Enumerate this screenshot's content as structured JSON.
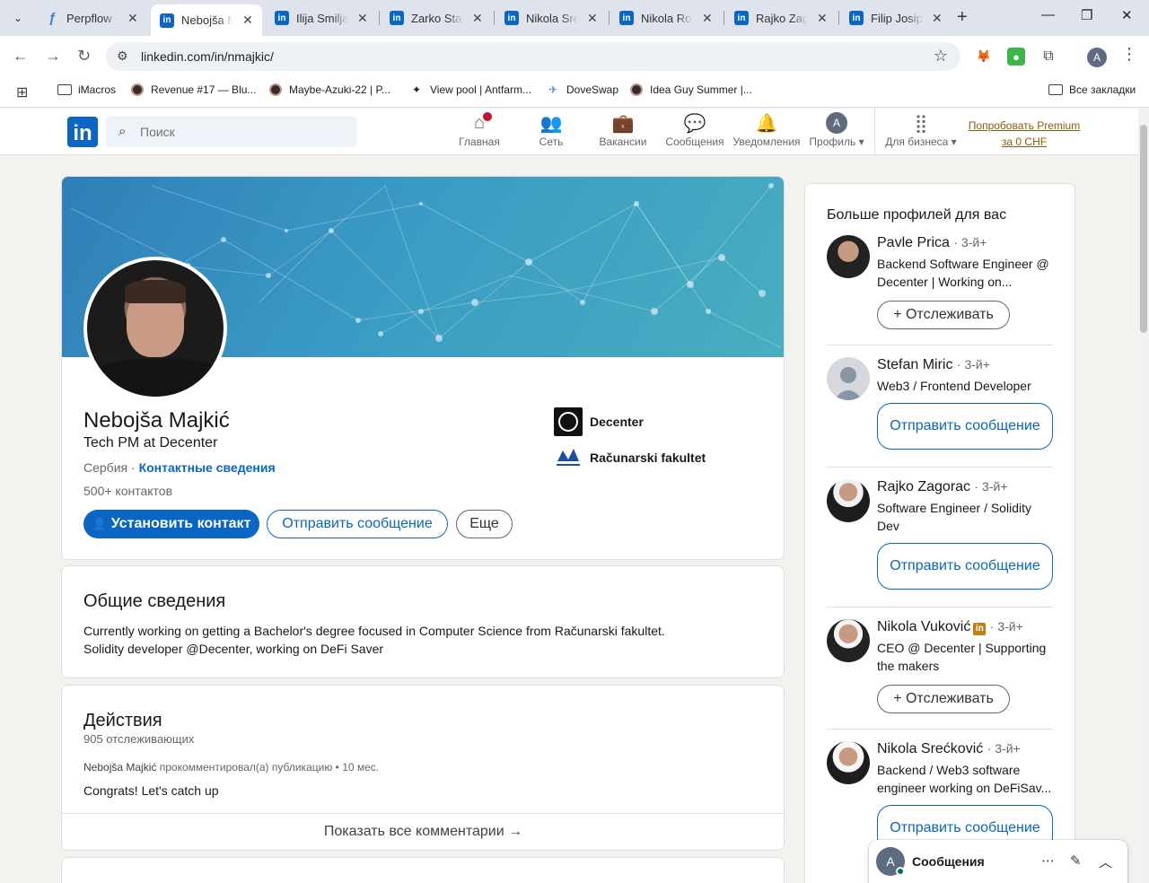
{
  "browser": {
    "tabs": [
      {
        "title": "Perpflow -",
        "icon": "perpflow-icon"
      },
      {
        "title": "Nebojša M",
        "icon": "linkedin-icon",
        "active": true
      },
      {
        "title": "Ilija Smiljan",
        "icon": "linkedin-icon"
      },
      {
        "title": "Zarko Stan",
        "icon": "linkedin-icon"
      },
      {
        "title": "Nikola Sreć",
        "icon": "linkedin-icon"
      },
      {
        "title": "Nikola Ro",
        "icon": "linkedin-icon"
      },
      {
        "title": "Rajko Zag",
        "icon": "linkedin-icon"
      },
      {
        "title": "Filip Josip",
        "icon": "linkedin-icon"
      }
    ],
    "url": "linkedin.com/in/nmajkic/",
    "profile_initial": "A",
    "bookmarks": [
      {
        "label": "iMacros"
      },
      {
        "label": "Revenue #17 — Blu..."
      },
      {
        "label": "Maybe-Azuki-22 | P..."
      },
      {
        "label": "View pool | Antfarm..."
      },
      {
        "label": "DoveSwap"
      },
      {
        "label": "Idea Guy Summer |..."
      }
    ],
    "all_bookmarks": "Все закладки"
  },
  "linkedin": {
    "logo": "in",
    "search_placeholder": "Поиск",
    "nav": {
      "home": "Главная",
      "network": "Сеть",
      "jobs": "Вакансии",
      "messages": "Сообщения",
      "notifications": "Уведомления",
      "profile": "Профиль",
      "business": "Для бизнеса"
    },
    "profile_initial": "A",
    "premium": "Попробовать Premium за 0 CHF"
  },
  "profile": {
    "name": "Nebojša Majkić",
    "headline": "Tech PM at Decenter",
    "location": "Сербия",
    "contact_link": "Контактные сведения",
    "connections": "500+ контактов",
    "connect_btn": "Установить контакт",
    "message_btn": "Отправить сообщение",
    "more_btn": "Еще",
    "orgs": [
      {
        "name": "Decenter"
      },
      {
        "name": "Računarski fakultet"
      }
    ]
  },
  "about": {
    "title": "Общие сведения",
    "line1": "Currently working on getting a Bachelor's degree focused in Computer Science from Računarski fakultet.",
    "line2": "Solidity developer @Decenter, working on DeFi Saver"
  },
  "activity": {
    "title": "Действия",
    "followers": "905 отслеживающих",
    "author": "Nebojša Majkić",
    "action": "прокомментировал(а) публикацию • 10 мес.",
    "comment": "Congrats! Let's catch up",
    "show_all": "Показать все комментарии →"
  },
  "sidebar": {
    "title": "Больше профилей для вас",
    "people": [
      {
        "name": "Pavle Prica",
        "degree": "· 3-й+",
        "desc": "Backend Software Engineer @ Decenter | Working on...",
        "button": "+ Отслеживать",
        "btn_type": "follow"
      },
      {
        "name": "Stefan Miric",
        "degree": "· 3-й+",
        "desc": "Web3 / Frontend Developer",
        "button": "Отправить сообщение",
        "btn_type": "msg"
      },
      {
        "name": "Rajko Zagorac",
        "degree": "· 3-й+",
        "desc": "Software Engineer / Solidity Dev",
        "button": "Отправить сообщение",
        "btn_type": "msg"
      },
      {
        "name": "Nikola Vuković",
        "degree": "· 3-й+",
        "desc": "CEO @ Decenter | Supporting the makers",
        "button": "+ Отслеживать",
        "btn_type": "follow",
        "premium": true
      },
      {
        "name": "Nikola Srećković",
        "degree": "· 3-й+",
        "desc": "Backend / Web3 software engineer working on DeFiSav...",
        "button": "Отправить сообщение",
        "btn_type": "msg"
      }
    ]
  },
  "messaging": {
    "title": "Сообщения",
    "initial": "A"
  },
  "colors": {
    "linkedin_blue": "#0a66c2",
    "premium_gold": "#915907",
    "page_bg": "#f4f2ee"
  }
}
